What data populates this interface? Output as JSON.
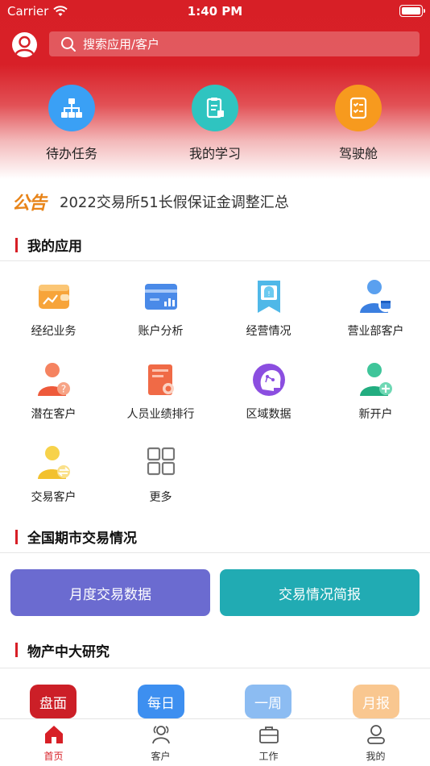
{
  "status_bar": {
    "carrier": "Carrier",
    "time": "1:40 PM"
  },
  "search": {
    "placeholder": "搜索应用/客户"
  },
  "quick_actions": [
    {
      "label": "待办任务",
      "icon": "org-chart-icon",
      "color": "#3aa0f5"
    },
    {
      "label": "我的学习",
      "icon": "study-notes-icon",
      "color": "#2fc4c0"
    },
    {
      "label": "驾驶舱",
      "icon": "checklist-icon",
      "color": "#f79a1e"
    }
  ],
  "notice": {
    "tag": "公告",
    "text": "2022交易所51长假保证金调整汇总"
  },
  "sections": {
    "my_apps": "我的应用",
    "market": "全国期市交易情况",
    "research": "物产中大研究"
  },
  "apps": [
    {
      "label": "经纪业务",
      "icon": "wallet-chart-icon"
    },
    {
      "label": "账户分析",
      "icon": "card-chart-icon"
    },
    {
      "label": "经营情况",
      "icon": "report-banner-icon"
    },
    {
      "label": "营业部客户",
      "icon": "user-calendar-icon"
    },
    {
      "label": "潜在客户",
      "icon": "user-question-icon"
    },
    {
      "label": "人员业绩排行",
      "icon": "certificate-icon"
    },
    {
      "label": "区域数据",
      "icon": "region-head-icon"
    },
    {
      "label": "新开户",
      "icon": "user-add-icon"
    },
    {
      "label": "交易客户",
      "icon": "user-exchange-icon"
    },
    {
      "label": "更多",
      "icon": "grid-more-icon"
    }
  ],
  "market_buttons": [
    {
      "label": "月度交易数据",
      "color": "#6b6bd0"
    },
    {
      "label": "交易情况简报",
      "color": "#21abb3"
    }
  ],
  "research_tabs": [
    {
      "label": "盘面",
      "color": "#cc1f27"
    },
    {
      "label": "每日",
      "color": "#3d8ff0"
    },
    {
      "label": "一周",
      "color": "#8cbcf2"
    },
    {
      "label": "月报",
      "color": "#f9c790"
    }
  ],
  "tabbar": [
    {
      "label": "首页",
      "icon": "home-icon"
    },
    {
      "label": "客户",
      "icon": "customers-icon"
    },
    {
      "label": "工作",
      "icon": "briefcase-icon"
    },
    {
      "label": "我的",
      "icon": "profile-icon"
    }
  ],
  "colors": {
    "brand": "#d71f26",
    "notice": "#e88419"
  }
}
